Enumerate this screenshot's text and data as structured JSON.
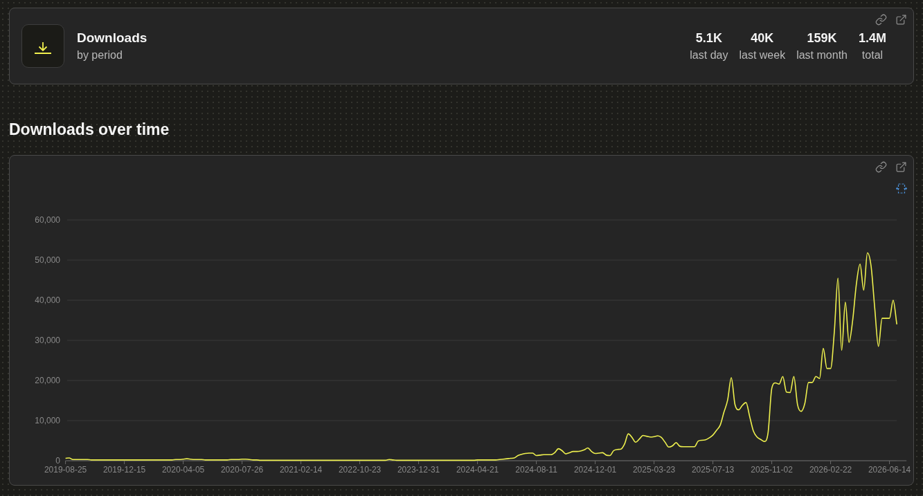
{
  "stats_card": {
    "title": "Downloads",
    "subtitle": "by period",
    "stats": [
      {
        "value": "5.1K",
        "label": "last day"
      },
      {
        "value": "40K",
        "label": "last week"
      },
      {
        "value": "159K",
        "label": "last month"
      },
      {
        "value": "1.4M",
        "label": "total"
      }
    ]
  },
  "section_title": "Downloads over time",
  "chart_card": {
    "chart_data": {
      "type": "line",
      "grid": true,
      "categories": [
        "2019-08-25",
        null,
        null,
        null,
        null,
        null,
        null,
        null,
        null,
        null,
        null,
        null,
        null,
        null,
        null,
        null,
        "2019-12-15",
        null,
        null,
        null,
        null,
        null,
        null,
        null,
        null,
        null,
        null,
        null,
        null,
        null,
        null,
        null,
        "2020-04-05",
        null,
        null,
        null,
        null,
        null,
        null,
        null,
        null,
        null,
        null,
        null,
        null,
        null,
        null,
        null,
        "2020-07-26",
        null,
        null,
        null,
        null,
        null,
        null,
        null,
        null,
        null,
        null,
        null,
        null,
        null,
        null,
        null,
        "2021-02-14",
        null,
        null,
        null,
        null,
        null,
        null,
        null,
        null,
        null,
        null,
        null,
        null,
        null,
        null,
        null,
        "2022-10-23",
        null,
        null,
        null,
        null,
        null,
        null,
        null,
        null,
        null,
        null,
        null,
        null,
        null,
        null,
        null,
        "2023-12-31",
        null,
        null,
        null,
        null,
        null,
        null,
        null,
        null,
        null,
        null,
        null,
        null,
        null,
        null,
        null,
        "2024-04-21",
        null,
        null,
        null,
        null,
        null,
        null,
        null,
        null,
        null,
        null,
        null,
        null,
        null,
        null,
        null,
        "2024-08-11",
        null,
        null,
        null,
        null,
        null,
        null,
        null,
        null,
        null,
        null,
        null,
        null,
        null,
        null,
        null,
        "2024-12-01",
        null,
        null,
        null,
        null,
        null,
        null,
        null,
        null,
        null,
        null,
        null,
        null,
        null,
        null,
        null,
        "2025-03-23",
        null,
        null,
        null,
        null,
        null,
        null,
        null,
        null,
        null,
        null,
        null,
        null,
        null,
        null,
        null,
        "2025-07-13",
        null,
        null,
        null,
        null,
        null,
        null,
        null,
        null,
        null,
        null,
        null,
        null,
        null,
        null,
        null,
        "2025-11-02",
        null,
        null,
        null,
        null,
        null,
        null,
        null,
        null,
        null,
        null,
        null,
        null,
        null,
        null,
        null,
        "2026-02-22",
        null,
        null,
        null,
        null,
        null,
        null,
        null,
        null,
        null,
        null,
        null,
        null,
        null,
        null,
        null,
        "2026-06-14",
        null,
        null
      ],
      "series": [
        {
          "color": "#eef04e",
          "values": [
            600,
            700,
            300,
            300,
            300,
            300,
            300,
            200,
            200,
            200,
            200,
            200,
            200,
            200,
            200,
            200,
            200,
            200,
            200,
            200,
            200,
            200,
            200,
            200,
            200,
            200,
            200,
            200,
            200,
            200,
            300,
            300,
            400,
            500,
            400,
            300,
            300,
            300,
            200,
            200,
            200,
            200,
            200,
            200,
            200,
            300,
            300,
            300,
            400,
            400,
            300,
            200,
            200,
            100,
            100,
            100,
            100,
            100,
            100,
            100,
            100,
            100,
            100,
            100,
            100,
            100,
            100,
            100,
            100,
            100,
            100,
            100,
            100,
            100,
            100,
            100,
            100,
            100,
            100,
            100,
            100,
            100,
            100,
            100,
            100,
            100,
            100,
            100,
            300,
            200,
            100,
            100,
            100,
            100,
            100,
            100,
            100,
            100,
            100,
            100,
            100,
            100,
            100,
            100,
            100,
            100,
            100,
            100,
            100,
            100,
            100,
            100,
            200,
            200,
            200,
            200,
            200,
            200,
            300,
            400,
            500,
            600,
            700,
            1300,
            1600,
            1800,
            1900,
            1900,
            1300,
            1400,
            1500,
            1500,
            1500,
            2000,
            3000,
            2500,
            1700,
            2000,
            2300,
            2300,
            2400,
            2700,
            3200,
            2300,
            1800,
            1900,
            2000,
            1400,
            1300,
            2500,
            2800,
            2900,
            4200,
            6700,
            5800,
            4600,
            5400,
            6300,
            6100,
            5900,
            6000,
            6200,
            5800,
            4600,
            3400,
            3700,
            4500,
            3600,
            3500,
            3500,
            3500,
            3500,
            4900,
            5100,
            5200,
            5700,
            6400,
            7600,
            8900,
            12100,
            15100,
            20700,
            14000,
            12700,
            13800,
            14500,
            11000,
            7400,
            5900,
            5300,
            4800,
            7000,
            18000,
            19400,
            19100,
            21000,
            17100,
            17000,
            21000,
            14000,
            12300,
            14300,
            19500,
            19500,
            21000,
            20500,
            28000,
            23000,
            23000,
            32000,
            45500,
            27500,
            39500,
            29500,
            35000,
            44000,
            49000,
            42500,
            51800,
            48500,
            38000,
            28500,
            35500,
            35500,
            35500,
            40000,
            34000
          ]
        }
      ],
      "ylim": [
        0,
        60000
      ],
      "yticks": [
        {
          "value": 0,
          "label": "0"
        },
        {
          "value": 10000,
          "label": "10,000"
        },
        {
          "value": 20000,
          "label": "20,000"
        },
        {
          "value": 30000,
          "label": "30,000"
        },
        {
          "value": 40000,
          "label": "40,000"
        },
        {
          "value": 50000,
          "label": "50,000"
        },
        {
          "value": 60000,
          "label": "60,000"
        }
      ]
    }
  }
}
